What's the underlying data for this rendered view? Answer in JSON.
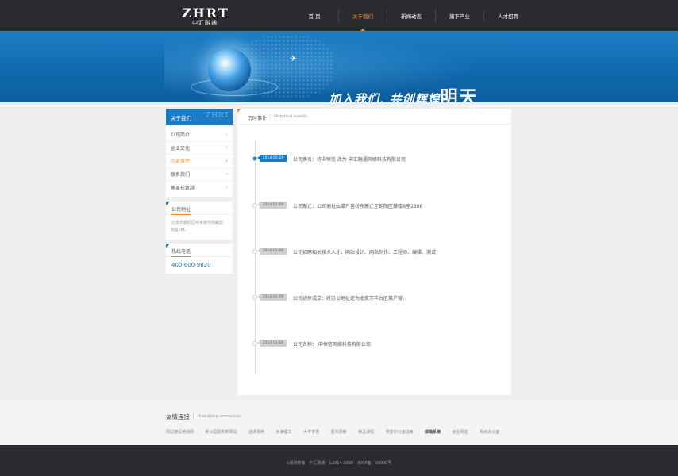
{
  "logo": {
    "letters": "ZHRT",
    "sub": "中汇融通"
  },
  "nav": [
    {
      "label": "首 页",
      "active": false
    },
    {
      "label": "关于我们",
      "active": true
    },
    {
      "label": "新闻动态",
      "active": false
    },
    {
      "label": "旗下产业",
      "active": false
    },
    {
      "label": "人才招聘",
      "active": false
    }
  ],
  "banner": {
    "slogan_part1": "加入我们, 共创辉煌",
    "slogan_part2": "明天"
  },
  "sidebar": {
    "title": "关于我们",
    "watermark": "ZHRT",
    "items": [
      {
        "label": "公司简介",
        "active": false
      },
      {
        "label": "企业文化",
        "active": false
      },
      {
        "label": "历史事件",
        "active": true
      },
      {
        "label": "联系我们",
        "active": false
      },
      {
        "label": "董事长致辞",
        "active": false
      }
    ],
    "address_title": "公司地址",
    "address": "北京市朝阳区呼家楼安翔路鼓 B座28C",
    "hotline_title": "热线电话",
    "hotline": "400-600-9820"
  },
  "main": {
    "title": "历时事件",
    "title_en": "Historical events",
    "events": [
      {
        "date": "2014-05-29",
        "text": "公司换名：将中恒信 改为 中汇融通网络科技有限公司",
        "active": true
      },
      {
        "date": "2014-01-09",
        "text": "公司搬迁：公司地址由菜户营桥东搬迁至朝阳区鼓楼B座2308",
        "active": false
      },
      {
        "date": "2014-01-09",
        "text": "公司招聘相关技术人才：网站设计、网站制作、工程师、编辑、测试",
        "active": false
      },
      {
        "date": "2014-01-09",
        "text": "公司初步成立：将办公地址定为北京市丰台区菜户营。",
        "active": false
      },
      {
        "date": "2014-01-09",
        "text": "公司名称： 中恒信网络科技有限公司",
        "active": false
      }
    ]
  },
  "friends": {
    "title": "友情连接",
    "title_en": "Friendship connection",
    "links": [
      {
        "label": "网站建设培训网",
        "bold": false
      },
      {
        "label": "新公园报务新网站",
        "bold": false
      },
      {
        "label": "选课系统",
        "bold": false
      },
      {
        "label": "天津理工",
        "bold": false
      },
      {
        "label": "大学学报",
        "bold": false
      },
      {
        "label": "图书网景",
        "bold": false
      },
      {
        "label": "精品课程",
        "bold": false
      },
      {
        "label": "党委办公室指南",
        "bold": false
      },
      {
        "label": "邮箱系统",
        "bold": true
      },
      {
        "label": "就业网名",
        "bold": false
      },
      {
        "label": "校长办公室",
        "bold": false
      }
    ]
  },
  "footer": {
    "copyright": "&版权所有",
    "company": "中汇融通",
    "years": "&2014-2020",
    "icp": "京ICP备 00000号"
  },
  "colors": {
    "header": "#2a2b2e",
    "accent": "#f08a24",
    "brand_blue": "#1a7cc4"
  }
}
